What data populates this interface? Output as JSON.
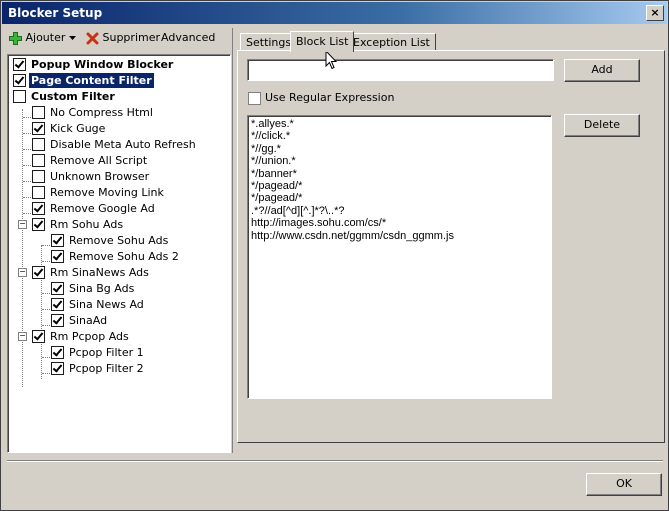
{
  "window": {
    "title": "Blocker Setup",
    "close": "×"
  },
  "toolbar": {
    "add_label": "Ajouter",
    "delete_label": "Supprimer",
    "advanced_label": "Advanced"
  },
  "tree": [
    {
      "label": "Popup Window Blocker",
      "checked": true,
      "bold": true
    },
    {
      "label": "Page Content Filter",
      "checked": true,
      "bold": true,
      "selected": true
    },
    {
      "label": "Custom Filter",
      "checked": false,
      "bold": true
    },
    {
      "label": "No Compress Html",
      "checked": false
    },
    {
      "label": "Kick Guge",
      "checked": true
    },
    {
      "label": "Disable Meta Auto Refresh",
      "checked": false
    },
    {
      "label": "Remove All Script",
      "checked": false
    },
    {
      "label": "Unknown Browser",
      "checked": false
    },
    {
      "label": "Remove Moving Link",
      "checked": false
    },
    {
      "label": "Remove Google Ad",
      "checked": true
    },
    {
      "label": "Rm Sohu Ads",
      "checked": true
    },
    {
      "label": "Remove Sohu Ads",
      "checked": true
    },
    {
      "label": "Remove Sohu Ads 2",
      "checked": true
    },
    {
      "label": "Rm SinaNews Ads",
      "checked": true
    },
    {
      "label": "Sina Bg Ads",
      "checked": true
    },
    {
      "label": "Sina News Ad",
      "checked": true
    },
    {
      "label": "SinaAd",
      "checked": true
    },
    {
      "label": "Rm Pcpop Ads",
      "checked": true
    },
    {
      "label": "Pcpop Filter 1",
      "checked": true
    },
    {
      "label": "Pcpop Filter 2",
      "checked": true
    }
  ],
  "tabs": [
    "Settings",
    "Block List",
    "Exception List"
  ],
  "active_tab": "Block List",
  "block_list": {
    "input_value": "",
    "add_label": "Add",
    "delete_label": "Delete",
    "regex_label": "Use Regular Expression",
    "regex_checked": false,
    "items": [
      "*.allyes.*",
      "*//click.*",
      "*//gg.*",
      "*//union.*",
      "*/banner*",
      "*/pagead/*",
      "*/pagead/*",
      ".*?//ad[^d][^.]*?\\..*?",
      "http://images.sohu.com/cs/*",
      "http://www.csdn.net/ggmm/csdn_ggmm.js"
    ]
  },
  "ok_label": "OK",
  "colors": {
    "title_start": "#0a246a",
    "title_end": "#a6caf0",
    "selection": "#0a246a",
    "face": "#d4d0c8"
  },
  "icons": {
    "add": "green-plus-icon",
    "delete": "red-x-icon",
    "dropdown": "dropdown-arrow-icon",
    "cursor": "mouse-pointer-icon"
  }
}
